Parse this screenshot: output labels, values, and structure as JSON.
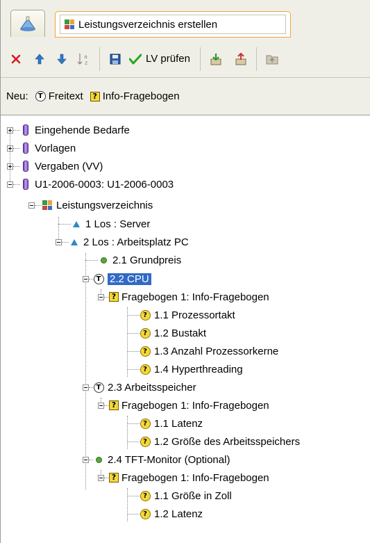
{
  "tabs": {
    "active_label": "Leistungsverzeichnis erstellen"
  },
  "toolbar": {
    "check_label": "LV prüfen"
  },
  "neu": {
    "label": "Neu:",
    "freitext": "Freitext",
    "fragebogen": "Info-Fragebogen"
  },
  "tree": {
    "n1": "Eingehende Bedarfe",
    "n2": "Vorlagen",
    "n3": "Vergaben (VV)",
    "n4": "U1-2006-0003:  U1-2006-0003",
    "n5": "Leistungsverzeichnis",
    "n6": "1 Los : Server",
    "n7": "2 Los : Arbeitsplatz PC",
    "n8": "2.1 Grundpreis",
    "n9": "2.2 CPU",
    "n10": "Fragebogen 1: Info-Fragebogen",
    "n11": "1.1 Prozessortakt",
    "n12": "1.2 Bustakt",
    "n13": "1.3 Anzahl Prozessorkerne",
    "n14": "1.4 Hyperthreading",
    "n15": "2.3 Arbeitsspeicher",
    "n16": "Fragebogen 1: Info-Fragebogen",
    "n17": "1.1 Latenz",
    "n18": "1.2 Größe des Arbeitsspeichers",
    "n19": "2.4 TFT-Monitor (Optional)",
    "n20": "Fragebogen 1: Info-Fragebogen",
    "n21": "1.1 Größe in Zoll",
    "n22": "1.2 Latenz"
  },
  "colors": {
    "selection": "#316ac5",
    "tab_active_border": "#f2a23a",
    "chrome": "#f0efe7"
  }
}
